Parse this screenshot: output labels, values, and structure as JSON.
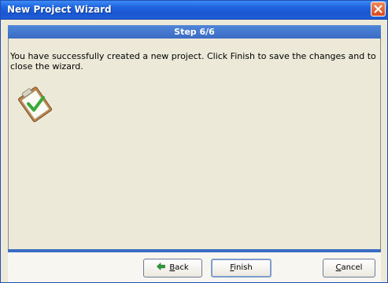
{
  "window": {
    "title": "New Project Wizard"
  },
  "step": {
    "label": "Step 6/6"
  },
  "message": "You have successfully created a new project. Click Finish to save the changes and to close the wizard.",
  "buttons": {
    "back": {
      "mnemonic": "B",
      "rest": "ack"
    },
    "finish": {
      "mnemonic": "F",
      "rest": "inish"
    },
    "cancel": {
      "mnemonic": "C",
      "rest": "ancel"
    }
  },
  "icons": {
    "close": "close-icon",
    "success": "clipboard-check-icon",
    "back": "back-arrow-icon"
  },
  "colors": {
    "title_bar": "#1f64e0",
    "step_bar": "#3a6cc4",
    "close_button": "#d8491e",
    "check": "#3aa83a"
  }
}
